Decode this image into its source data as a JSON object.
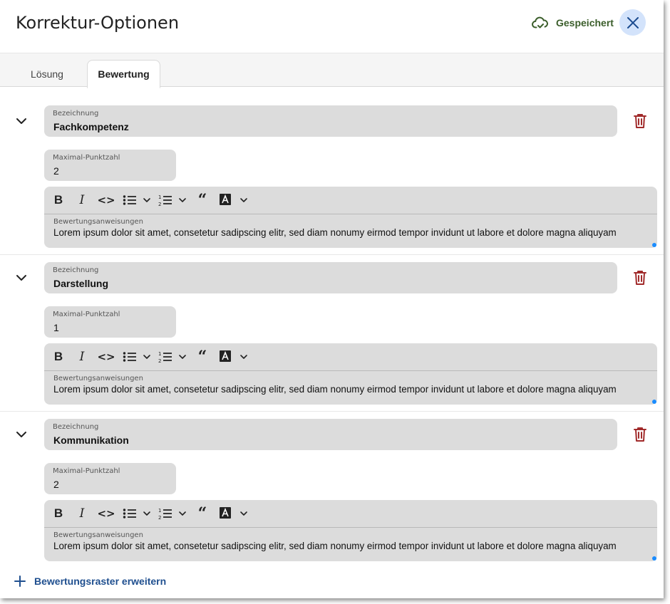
{
  "header": {
    "title": "Korrektur-Optionen",
    "saved_label": "Gespeichert",
    "saved_icon": "cloud-check-icon",
    "close_icon": "close-icon",
    "accent": "#d3e3fb"
  },
  "tabs": [
    {
      "label": "Lösung",
      "active": false
    },
    {
      "label": "Bewertung",
      "active": true
    }
  ],
  "criteria": [
    {
      "name_label": "Bezeichnung",
      "name": "Fachkompetenz",
      "points_label": "Maximal-Punktzahl",
      "points": "2",
      "instructions_label": "Bewertungsanweisungen",
      "instructions": "Lorem ipsum dolor sit amet, consetetur sadipscing elitr, sed diam nonumy eirmod tempor invidunt ut labore et dolore magna aliquyam"
    },
    {
      "name_label": "Bezeichnung",
      "name": "Darstellung",
      "points_label": "Maximal-Punktzahl",
      "points": "1",
      "instructions_label": "Bewertungsanweisungen",
      "instructions": "Lorem ipsum dolor sit amet, consetetur sadipscing elitr, sed diam nonumy eirmod tempor invidunt ut labore et dolore magna aliquyam"
    },
    {
      "name_label": "Bezeichnung",
      "name": "Kommunikation",
      "points_label": "Maximal-Punktzahl",
      "points": "2",
      "instructions_label": "Bewertungsanweisungen",
      "instructions": "Lorem ipsum dolor sit amet, consetetur sadipscing elitr, sed diam nonumy eirmod tempor invidunt ut labore et dolore magna aliquyam"
    }
  ],
  "toolbar": {
    "bold": "B",
    "italic": "I",
    "code": "<>",
    "quote": "“"
  },
  "footer": {
    "add_label": "Bewertungsraster erweitern"
  },
  "colors": {
    "delete_icon": "#a12b2b",
    "saved_text": "#3b5e2b",
    "link": "#1f4f8f",
    "field_bg": "#dcdcdc"
  }
}
